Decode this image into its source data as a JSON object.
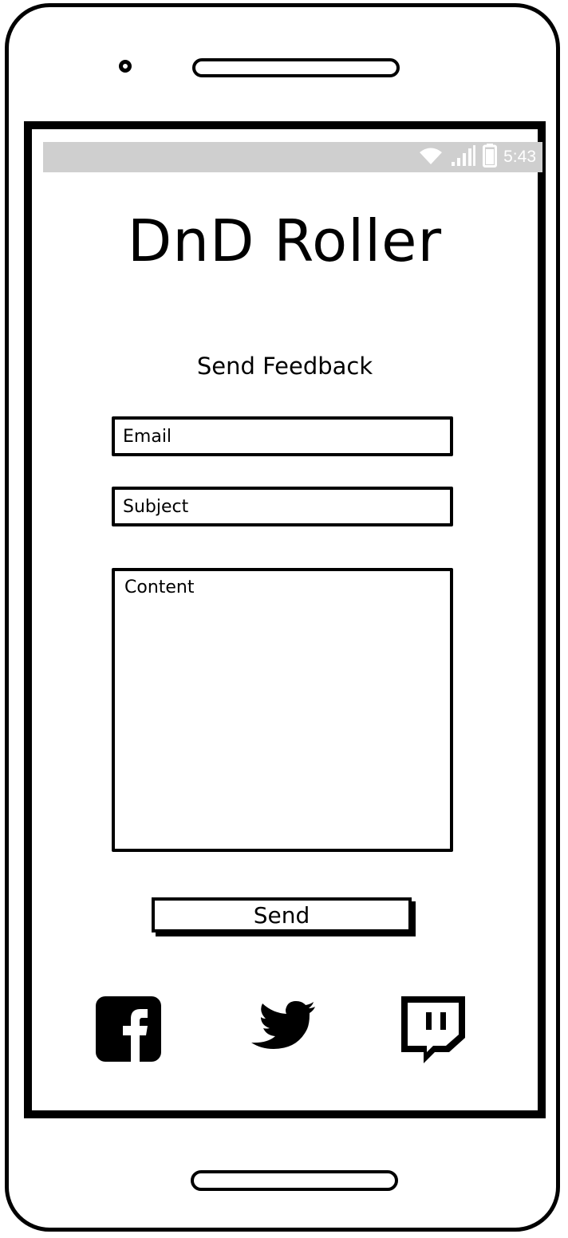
{
  "status_bar": {
    "time": "5:43",
    "icons": [
      "wifi-icon",
      "signal-icon",
      "battery-icon"
    ],
    "background": "#cfcfcf"
  },
  "app": {
    "title": "DnD Roller"
  },
  "feedback": {
    "heading": "Send Feedback",
    "email_placeholder": "Email",
    "subject_placeholder": "Subject",
    "content_placeholder": "Content",
    "send_label": "Send"
  },
  "social": [
    {
      "name": "facebook",
      "icon": "facebook-icon"
    },
    {
      "name": "twitter",
      "icon": "twitter-icon"
    },
    {
      "name": "twitch",
      "icon": "twitch-icon"
    }
  ]
}
